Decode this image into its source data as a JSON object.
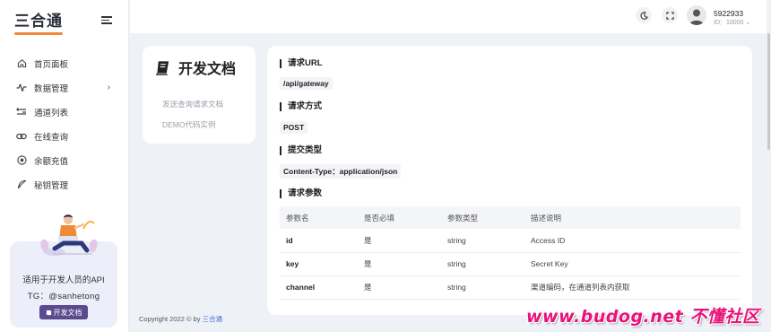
{
  "brand": {
    "logo_text": "三合通"
  },
  "sidebar": {
    "items": [
      {
        "label": "首页面板",
        "icon": "home-icon"
      },
      {
        "label": "数据管理",
        "icon": "activity-icon",
        "has_children": true
      },
      {
        "label": "通道列表",
        "icon": "route-icon"
      },
      {
        "label": "在线查询",
        "icon": "link-icon"
      },
      {
        "label": "余额充值",
        "icon": "target-icon"
      },
      {
        "label": "秘钥管理",
        "icon": "key-icon"
      }
    ],
    "promo": {
      "title": "适用于开发人员的API",
      "subtitle": "TG：@sanhetong",
      "button_label": "开发文档"
    }
  },
  "header": {
    "user_name": "5922933",
    "user_id": "ID：10000",
    "icons": [
      "moon-icon",
      "fullscreen-icon",
      "user-avatar"
    ]
  },
  "doc_nav": {
    "title": "开发文档",
    "links": [
      "发送查询请求文档",
      "DEMO代码实例"
    ]
  },
  "content": {
    "url_heading": "请求URL",
    "url_value": "/api/gateway",
    "method_heading": "请求方式",
    "method_value": "POST",
    "content_type_heading": "提交类型",
    "content_type_value": "Content-Type：application/json",
    "params_heading": "请求参数",
    "table_headers": [
      "参数名",
      "是否必填",
      "参数类型",
      "描述说明"
    ],
    "table_rows": [
      [
        "id",
        "是",
        "string",
        "Access ID"
      ],
      [
        "key",
        "是",
        "string",
        "Secret Key"
      ],
      [
        "channel",
        "是",
        "string",
        "渠道编码，在通道列表内获取"
      ]
    ]
  },
  "footer": {
    "text": "Copyright 2022 © by",
    "link": "三合通"
  },
  "watermark": "www.budog.net 不懂社区",
  "colors": {
    "accent": "#5b4a8f",
    "logo_underline": "#f0883a",
    "link": "#3a66d8",
    "watermark": "#e8127a"
  }
}
